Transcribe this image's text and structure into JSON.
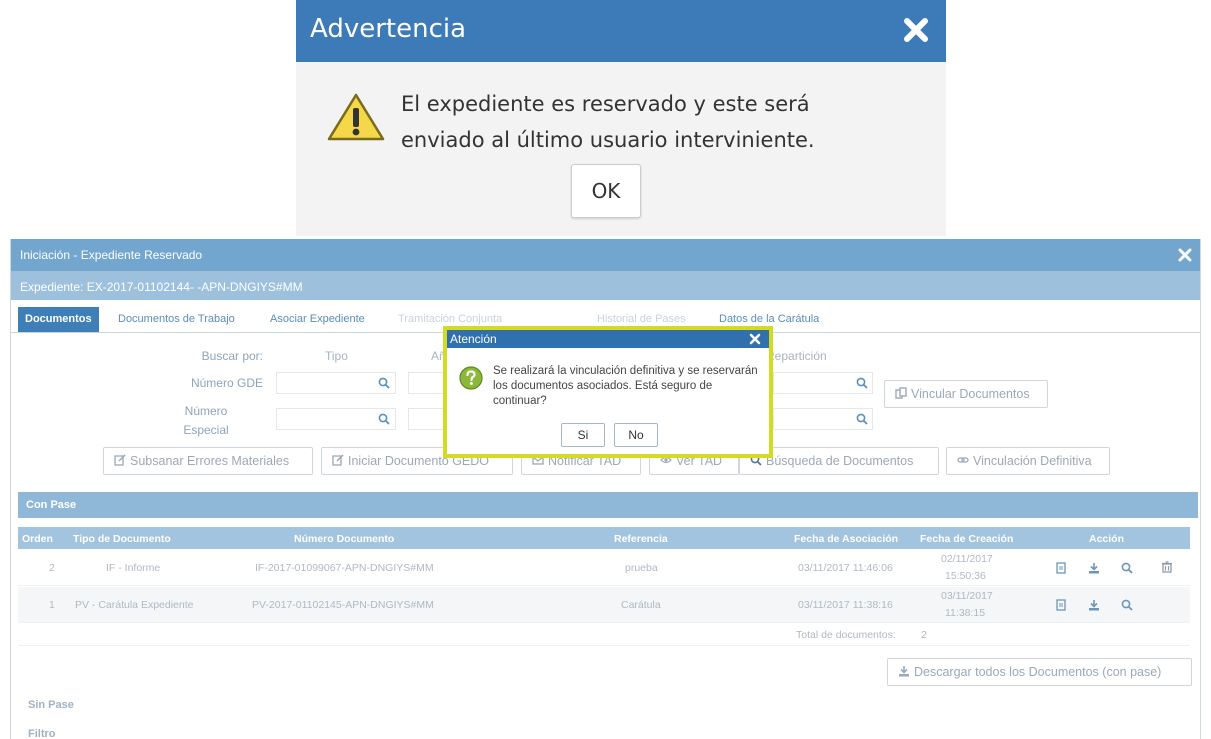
{
  "warning_dialog": {
    "title": "Advertencia",
    "message_line1": "El expediente es reservado y este será",
    "message_line2": "enviado al último usuario interviniente.",
    "ok_label": "OK"
  },
  "window": {
    "title": "Iniciación - Expediente Reservado",
    "expediente": "Expediente: EX-2017-01102144- -APN-DNGIYS#MM"
  },
  "tabs": [
    {
      "label": "Documentos"
    },
    {
      "label": "Documentos de Trabajo"
    },
    {
      "label": "Asociar Expediente"
    },
    {
      "label": "Tramitación Conjunta"
    },
    {
      "label": "Historial de Pases"
    },
    {
      "label": "Datos de la Carátula"
    }
  ],
  "search": {
    "buscar_por": "Buscar por:",
    "col_tipo": "Tipo",
    "col_anio": "Año",
    "col_reparticion": "Repartición",
    "numero_gde": "Número GDE",
    "numero_especial_1": "Número",
    "numero_especial_2": "Especial",
    "vincular_label": "Vincular Documentos"
  },
  "actions": {
    "subsanar": "Subsanar Errores Materiales",
    "iniciar": "Iniciar Documento GEDO",
    "notificar": "Notificar TAD",
    "ver_tad": "Ver TAD",
    "busqueda": "Búsqueda de Documentos",
    "vinculacion": "Vinculación Definitiva"
  },
  "con_pase": {
    "section_label": "Con Pase",
    "headers": [
      "Orden",
      "Tipo de Documento",
      "Número Documento",
      "Referencia",
      "Fecha de Asociación",
      "Fecha de Creación",
      "Acción"
    ],
    "rows": [
      {
        "orden": "2",
        "tipo": "IF - Informe",
        "numero": "IF-2017-01099067-APN-DNGIYS#MM",
        "referencia": "prueba",
        "fecha_asoc": "03/11/2017 11:46:06",
        "fecha_crea_1": "02/11/2017",
        "fecha_crea_2": "15:50:36"
      },
      {
        "orden": "1",
        "tipo": "PV - Carátula Expediente",
        "numero": "PV-2017-01102145-APN-DNGIYS#MM",
        "referencia": "Carátula",
        "fecha_asoc": "03/11/2017 11:38:16",
        "fecha_crea_1": "03/11/2017",
        "fecha_crea_2": "11:38:15"
      }
    ],
    "total_label": "Total de documentos:",
    "total_value": "2",
    "download_all": "Descargar todos los Documentos (con pase)"
  },
  "sin_pase": {
    "label": "Sin Pase"
  },
  "filtro": {
    "label": "Filtro"
  },
  "confirm_modal": {
    "title": "Atención",
    "message": "Se realizará la vinculación definitiva y se reservarán los documentos asociados. Está seguro de continuar?",
    "si_label": "Si",
    "no_label": "No"
  },
  "colors": {
    "title_blue": "#3d7ab8",
    "window_title": "#73a6cf",
    "modal_border": "#d4dc22"
  },
  "icons": [
    "warning-triangle-icon",
    "close-icon",
    "search-icon",
    "link-icon",
    "edit-icon",
    "envelope-icon",
    "eye-icon",
    "magnifier-icon",
    "chain-icon",
    "document-icon",
    "download-icon",
    "trash-icon",
    "question-icon"
  ]
}
